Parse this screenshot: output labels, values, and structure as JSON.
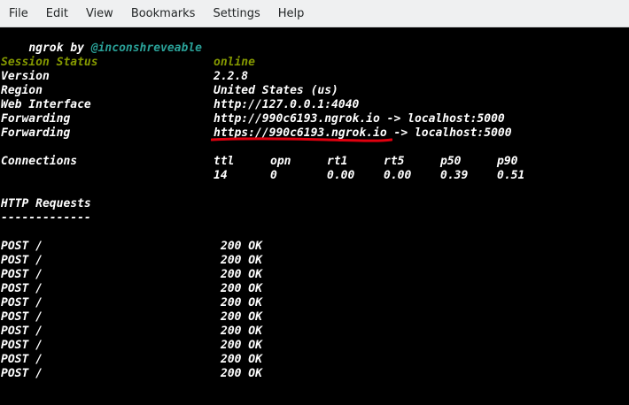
{
  "menubar": {
    "items": [
      "File",
      "Edit",
      "View",
      "Bookmarks",
      "Settings",
      "Help"
    ]
  },
  "terminal": {
    "banner_prefix": "ngrok by",
    "banner_handle": "@inconshreveable",
    "session_status_label": "Session Status",
    "session_status_value": "online",
    "info": [
      {
        "label": "Version",
        "value": "2.2.8"
      },
      {
        "label": "Region",
        "value": "United States (us)"
      },
      {
        "label": "Web Interface",
        "value": "http://127.0.0.1:4040"
      },
      {
        "label": "Forwarding",
        "value": "http://990c6193.ngrok.io -> localhost:5000"
      },
      {
        "label": "Forwarding",
        "value": "https://990c6193.ngrok.io -> localhost:5000"
      }
    ],
    "connections": {
      "label": "Connections",
      "headers": [
        "ttl",
        "opn",
        "rt1",
        "rt5",
        "p50",
        "p90"
      ],
      "values": [
        "14",
        "0",
        "0.00",
        "0.00",
        "0.39",
        "0.51"
      ]
    },
    "http_requests_title": "HTTP Requests",
    "http_requests_rule": "-------------",
    "requests": [
      {
        "method": "POST /",
        "status": "200 OK"
      },
      {
        "method": "POST /",
        "status": "200 OK"
      },
      {
        "method": "POST /",
        "status": "200 OK"
      },
      {
        "method": "POST /",
        "status": "200 OK"
      },
      {
        "method": "POST /",
        "status": "200 OK"
      },
      {
        "method": "POST /",
        "status": "200 OK"
      },
      {
        "method": "POST /",
        "status": "200 OK"
      },
      {
        "method": "POST /",
        "status": "200 OK"
      },
      {
        "method": "POST /",
        "status": "200 OK"
      },
      {
        "method": "POST /",
        "status": "200 OK"
      }
    ]
  },
  "colors": {
    "terminal_bg": "#000000",
    "text": "#ffffff",
    "handle": "#2aa198",
    "status_online": "#859900",
    "annotation_underline": "#e0000f"
  }
}
